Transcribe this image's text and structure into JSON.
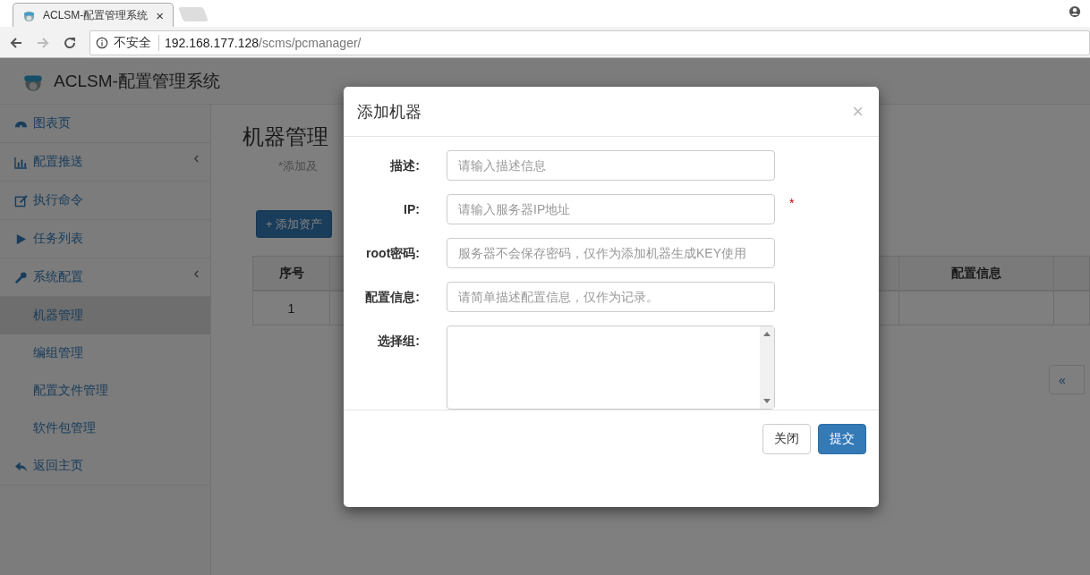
{
  "browser": {
    "tab_title": "ACLSM-配置管理系统",
    "tab_close": "×",
    "address": {
      "security": "不安全",
      "host": "192.168.177.128",
      "path": "/scms/pcmanager/"
    }
  },
  "app": {
    "brand": "ACLSM-配置管理系统"
  },
  "sidebar": {
    "items": [
      {
        "label": "图表页",
        "selected": false
      },
      {
        "label": "配置推送",
        "has_submenu": true,
        "selected": false
      },
      {
        "label": "执行命令",
        "selected": false
      },
      {
        "label": "任务列表",
        "selected": false
      },
      {
        "label": "系统配置",
        "has_submenu": true,
        "selected": false,
        "children": [
          {
            "label": "机器管理",
            "selected": true
          },
          {
            "label": "编组管理",
            "selected": false
          },
          {
            "label": "配置文件管理",
            "selected": false
          },
          {
            "label": "软件包管理",
            "selected": false
          }
        ]
      },
      {
        "label": "返回主页",
        "selected": false
      }
    ]
  },
  "page": {
    "title": "机器管理",
    "subtitle": "*添加及",
    "add_button": "+ 添加资产",
    "table": {
      "columns": [
        "序号",
        "配置信息"
      ],
      "rows": [
        {
          "cells": [
            "1"
          ]
        }
      ]
    },
    "pagination": [
      "«"
    ]
  },
  "modal": {
    "title": "添加机器",
    "close": "×",
    "fields": [
      {
        "kind": "input",
        "label": "描述:",
        "placeholder": "请输入描述信息"
      },
      {
        "kind": "input",
        "label": "IP:",
        "placeholder": "请输入服务器IP地址",
        "required_mark": "*"
      },
      {
        "kind": "input",
        "label": "root密码:",
        "placeholder": "服务器不会保存密码，仅作为添加机器生成KEY使用"
      },
      {
        "kind": "input",
        "label": "配置信息:",
        "placeholder": "请简单描述配置信息，仅作为记录。"
      },
      {
        "kind": "select",
        "label": "选择组:"
      }
    ],
    "buttons": [
      {
        "kind": "default",
        "label": "关闭"
      },
      {
        "kind": "primary",
        "label": "提交"
      }
    ]
  }
}
